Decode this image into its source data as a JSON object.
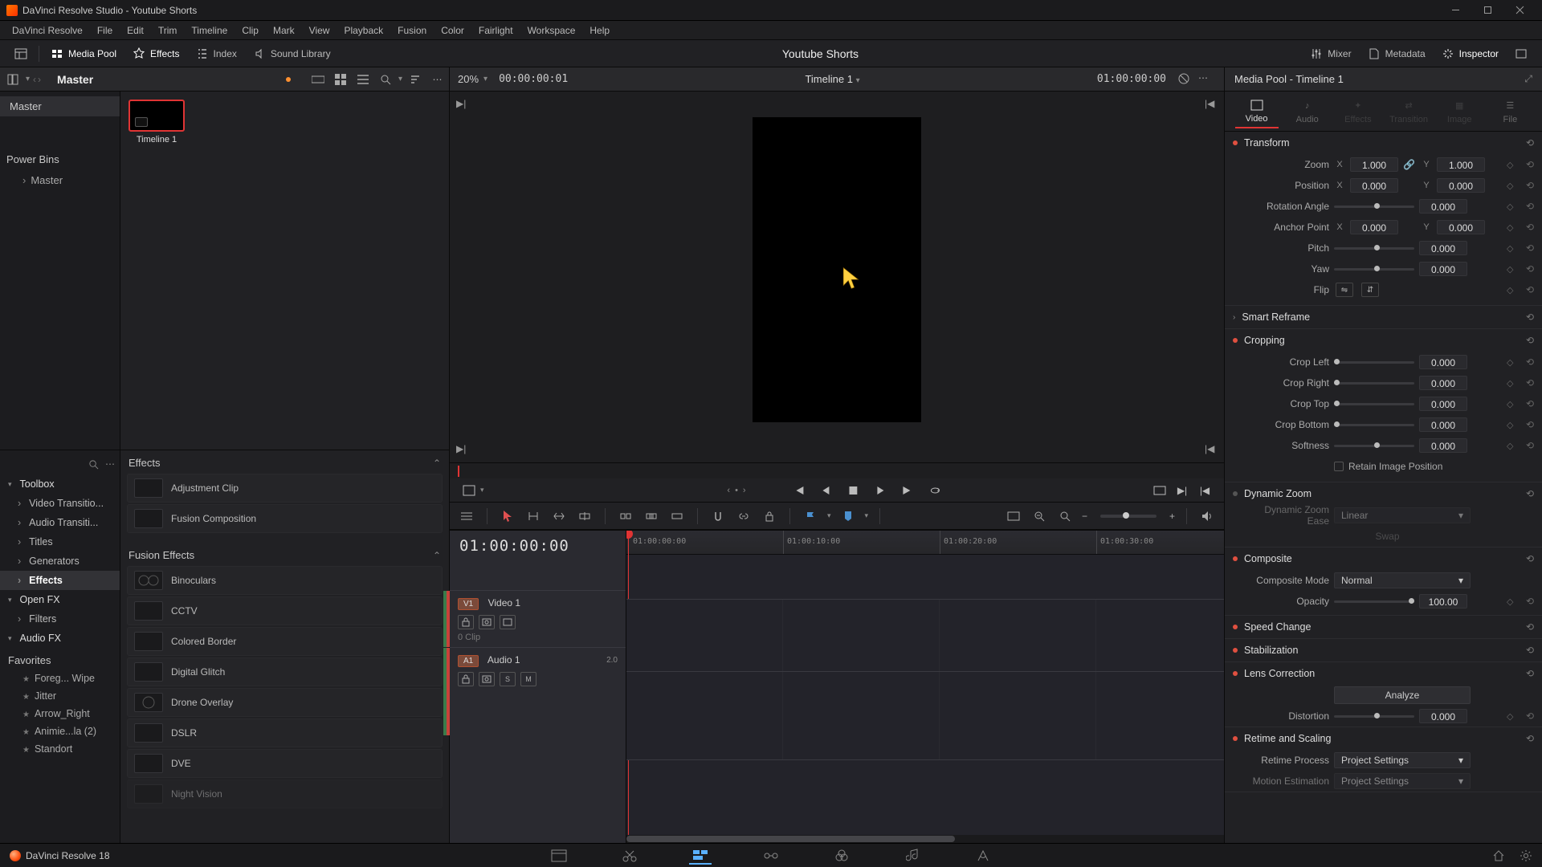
{
  "titlebar": {
    "title": "DaVinci Resolve Studio - Youtube Shorts"
  },
  "menubar": [
    "DaVinci Resolve",
    "File",
    "Edit",
    "Trim",
    "Timeline",
    "Clip",
    "Mark",
    "View",
    "Playback",
    "Fusion",
    "Color",
    "Fairlight",
    "Workspace",
    "Help"
  ],
  "toptool": {
    "left": [
      {
        "label": "",
        "name": "layout-btn"
      },
      {
        "label": "Media Pool",
        "name": "media-pool-btn",
        "active": true
      },
      {
        "label": "Effects",
        "name": "effects-btn",
        "active": true
      },
      {
        "label": "Index",
        "name": "index-btn"
      },
      {
        "label": "Sound Library",
        "name": "sound-library-btn"
      }
    ],
    "project": "Youtube Shorts",
    "right": [
      {
        "label": "Mixer",
        "name": "mixer-btn"
      },
      {
        "label": "Metadata",
        "name": "metadata-btn"
      },
      {
        "label": "Inspector",
        "name": "inspector-btn",
        "active": true
      },
      {
        "label": "",
        "name": "full-viewer-btn"
      }
    ]
  },
  "media_pool": {
    "header": {
      "breadcrumb": "Master"
    },
    "tree": {
      "root": "Master",
      "power_bins": "Power Bins",
      "sub": "Master"
    },
    "clips": [
      {
        "name": "Timeline 1"
      }
    ]
  },
  "fx_tree": {
    "toolbox": "Toolbox",
    "items": [
      "Video Transitio...",
      "Audio Transiti...",
      "Titles",
      "Generators",
      "Effects"
    ],
    "openfx": "Open FX",
    "filters": "Filters",
    "audiofx": "Audio FX",
    "favorites": "Favorites",
    "favs": [
      "Foreg... Wipe",
      "Jitter",
      "Arrow_Right",
      "Animie...la (2)",
      "Standort"
    ]
  },
  "fx_list": {
    "sections": [
      {
        "title": "Effects",
        "items": [
          "Adjustment Clip",
          "Fusion Composition"
        ]
      },
      {
        "title": "Fusion Effects",
        "items": [
          "Binoculars",
          "CCTV",
          "Colored Border",
          "Digital Glitch",
          "Drone Overlay",
          "DSLR",
          "DVE",
          "Night Vision"
        ]
      }
    ]
  },
  "viewer": {
    "zoom": "20%",
    "tc_left": "00:00:00:01",
    "timeline_name": "Timeline 1",
    "tc_right": "01:00:00:00"
  },
  "timeline": {
    "tc_big": "01:00:00:00",
    "ruler": [
      "01:00:00:00",
      "01:00:10:00",
      "01:00:20:00",
      "01:00:30:00"
    ],
    "v1": {
      "badge": "V1",
      "name": "Video 1",
      "count": "0 Clip"
    },
    "a1": {
      "badge": "A1",
      "name": "Audio 1",
      "ch": "2.0"
    }
  },
  "inspector": {
    "title": "Media Pool - Timeline 1",
    "tabs": [
      "Video",
      "Audio",
      "Effects",
      "Transition",
      "Image",
      "File"
    ],
    "transform": {
      "title": "Transform",
      "zoom": "Zoom",
      "zoom_x": "1.000",
      "zoom_y": "1.000",
      "position": "Position",
      "pos_x": "0.000",
      "pos_y": "0.000",
      "rotation": "Rotation Angle",
      "rotation_v": "0.000",
      "anchor": "Anchor Point",
      "anchor_x": "0.000",
      "anchor_y": "0.000",
      "pitch": "Pitch",
      "pitch_v": "0.000",
      "yaw": "Yaw",
      "yaw_v": "0.000",
      "flip": "Flip"
    },
    "smart_reframe": "Smart Reframe",
    "cropping": {
      "title": "Cropping",
      "left": "Crop Left",
      "left_v": "0.000",
      "right": "Crop Right",
      "right_v": "0.000",
      "top": "Crop Top",
      "top_v": "0.000",
      "bottom": "Crop Bottom",
      "bottom_v": "0.000",
      "soft": "Softness",
      "soft_v": "0.000",
      "retain": "Retain Image Position"
    },
    "dynamic_zoom": {
      "title": "Dynamic Zoom",
      "ease": "Dynamic Zoom Ease",
      "ease_v": "Linear",
      "swap": "Swap"
    },
    "composite": {
      "title": "Composite",
      "mode": "Composite Mode",
      "mode_v": "Normal",
      "opacity": "Opacity",
      "opacity_v": "100.00"
    },
    "speed": "Speed Change",
    "stab": "Stabilization",
    "lens": {
      "title": "Lens Correction",
      "analyze": "Analyze",
      "dist": "Distortion",
      "dist_v": "0.000"
    },
    "retime": {
      "title": "Retime and Scaling",
      "proc": "Retime Process",
      "proc_v": "Project Settings",
      "mot": "Motion Estimation",
      "mot_v": "Project Settings"
    }
  },
  "pagebar": {
    "app": "DaVinci Resolve 18"
  }
}
